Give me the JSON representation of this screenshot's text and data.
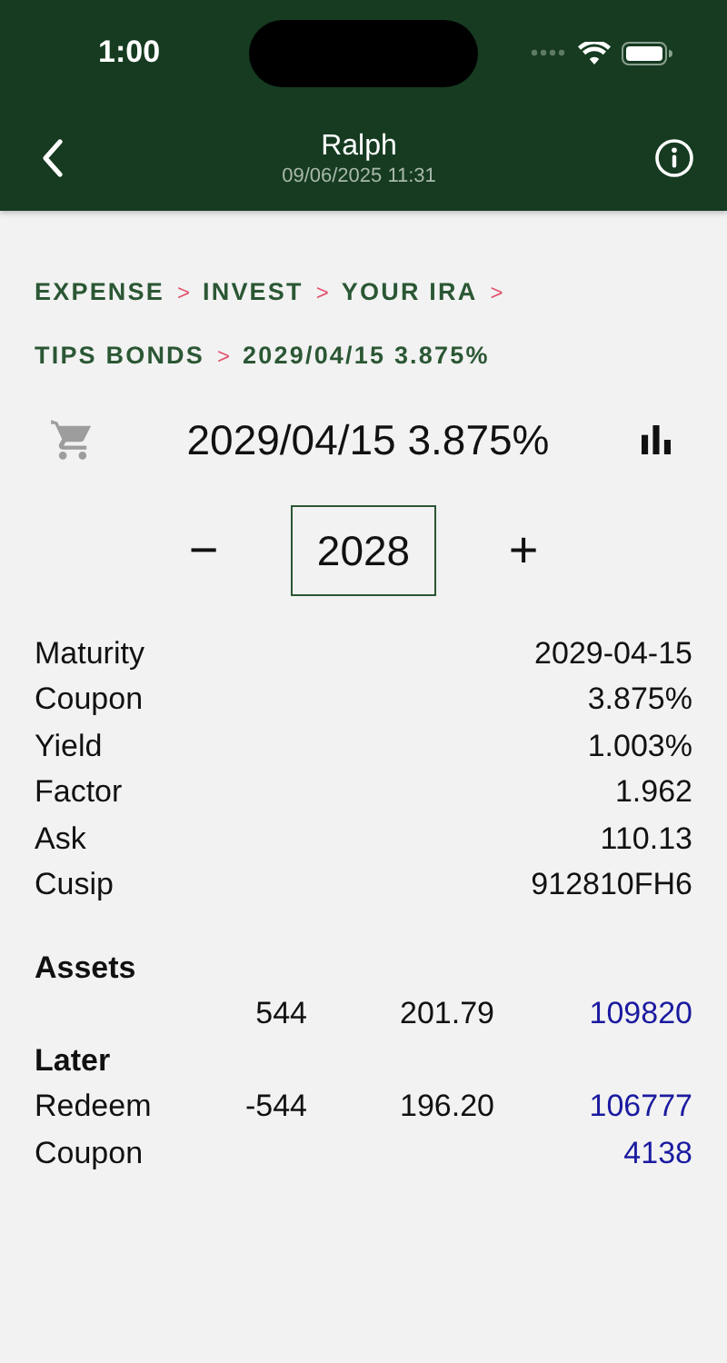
{
  "status_bar": {
    "time": "1:00"
  },
  "nav": {
    "title": "Ralph",
    "subtitle": "09/06/2025 11:31"
  },
  "breadcrumb_lines": [
    [
      {
        "label": "EXPENSE",
        "separator": ">"
      },
      {
        "label": "INVEST",
        "separator": ">"
      },
      {
        "label": "YOUR IRA",
        "separator": ">"
      }
    ],
    [
      {
        "label": "TIPS BONDS",
        "separator": ">"
      },
      {
        "label": "2029/04/15 3.875%"
      }
    ]
  ],
  "header": {
    "title": "2029/04/15 3.875%",
    "cart_disabled": true
  },
  "stepper": {
    "minus": "−",
    "value": "2028",
    "plus": "+"
  },
  "details": [
    {
      "label": "Maturity",
      "value": "2029-04-15"
    },
    {
      "label": "Coupon",
      "value": "3.875%"
    },
    {
      "label": "Yield",
      "value": "1.003%"
    },
    {
      "label": "Factor",
      "value": "1.962"
    },
    {
      "label": "Ask",
      "value": "110.13"
    },
    {
      "label": "Cusip",
      "value": "912810FH6"
    }
  ],
  "sections": [
    {
      "title": "Assets",
      "rows": [
        {
          "quantity": "544",
          "price": "201.79",
          "amount": "109820"
        }
      ]
    },
    {
      "title": "Later",
      "rows": [
        {
          "label": "Redeem",
          "quantity": "-544",
          "price": "196.20",
          "amount": "106777"
        },
        {
          "label": "Coupon",
          "amount": "4138"
        }
      ]
    }
  ]
}
